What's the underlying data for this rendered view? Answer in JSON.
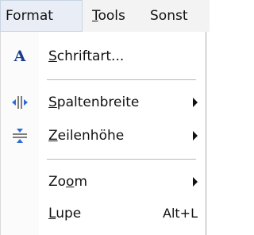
{
  "menubar": {
    "items": [
      {
        "label": "Format",
        "mnemonic_index": -1
      },
      {
        "label": "Tools",
        "mnemonic_index": 0
      },
      {
        "label": "Sonst",
        "mnemonic_index": -1
      }
    ]
  },
  "menu": {
    "items": [
      {
        "label": "Schriftart...",
        "mnemonic_index": 0,
        "icon": "font-icon",
        "has_submenu": false,
        "shortcut": ""
      },
      {
        "label": "Spaltenbreite",
        "mnemonic_index": 0,
        "icon": "column-width-icon",
        "has_submenu": true,
        "shortcut": ""
      },
      {
        "label": "Zeilenhöhe",
        "mnemonic_index": 0,
        "icon": "row-height-icon",
        "has_submenu": true,
        "shortcut": ""
      },
      {
        "label": "Zoom",
        "mnemonic_index": 2,
        "icon": "",
        "has_submenu": true,
        "shortcut": ""
      },
      {
        "label": "Lupe",
        "mnemonic_index": 0,
        "icon": "",
        "has_submenu": false,
        "shortcut": "Alt+L"
      }
    ]
  },
  "colors": {
    "icon_blue": "#1a3c8c",
    "menubar_bg": "#f3f3f3",
    "menu_bg": "#ffffff"
  }
}
